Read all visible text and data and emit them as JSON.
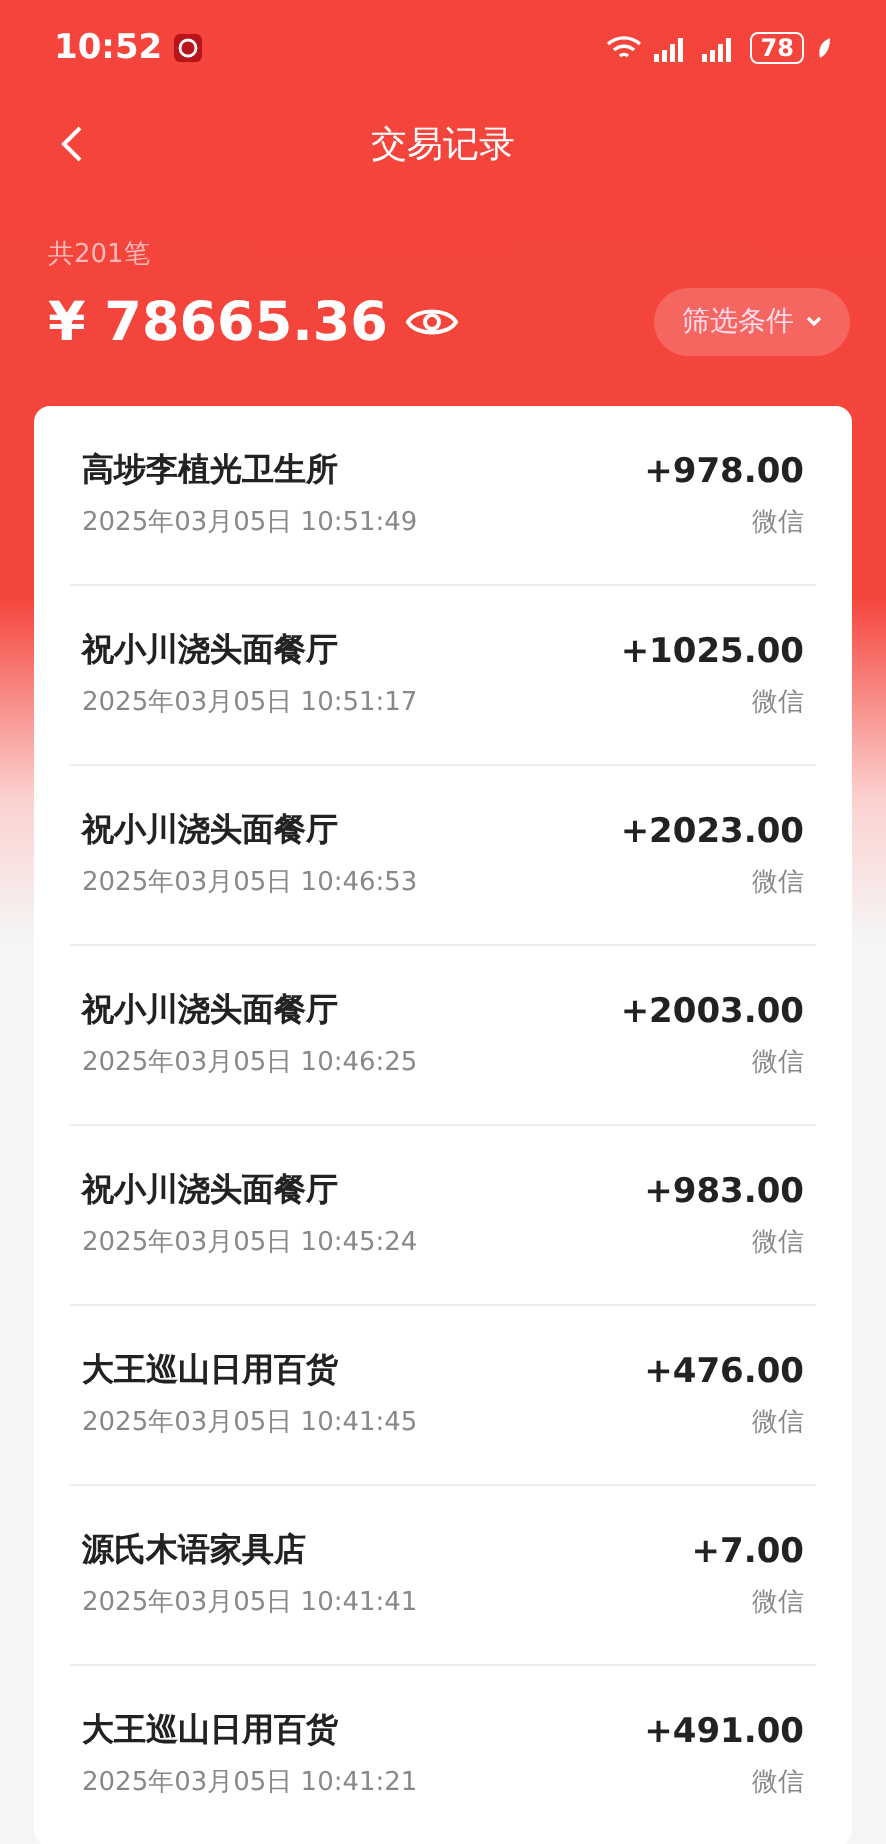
{
  "status_bar": {
    "time": "10:52",
    "battery": "78"
  },
  "header": {
    "title": "交易记录"
  },
  "summary": {
    "count": "共201笔",
    "amount": "¥ 78665.36",
    "filter": "筛选条件"
  },
  "transactions": [
    {
      "merchant": "高埗李植光卫生所",
      "time": "2025年03月05日 10:51:49",
      "amount": "+978.00",
      "channel": "微信"
    },
    {
      "merchant": "祝小川浇头面餐厅",
      "time": "2025年03月05日 10:51:17",
      "amount": "+1025.00",
      "channel": "微信"
    },
    {
      "merchant": "祝小川浇头面餐厅",
      "time": "2025年03月05日 10:46:53",
      "amount": "+2023.00",
      "channel": "微信"
    },
    {
      "merchant": "祝小川浇头面餐厅",
      "time": "2025年03月05日 10:46:25",
      "amount": "+2003.00",
      "channel": "微信"
    },
    {
      "merchant": "祝小川浇头面餐厅",
      "time": "2025年03月05日 10:45:24",
      "amount": "+983.00",
      "channel": "微信"
    },
    {
      "merchant": "大王巡山日用百货",
      "time": "2025年03月05日 10:41:45",
      "amount": "+476.00",
      "channel": "微信"
    },
    {
      "merchant": "源氏木语家具店",
      "time": "2025年03月05日 10:41:41",
      "amount": "+7.00",
      "channel": "微信"
    },
    {
      "merchant": "大王巡山日用百货",
      "time": "2025年03月05日 10:41:21",
      "amount": "+491.00",
      "channel": "微信"
    }
  ]
}
